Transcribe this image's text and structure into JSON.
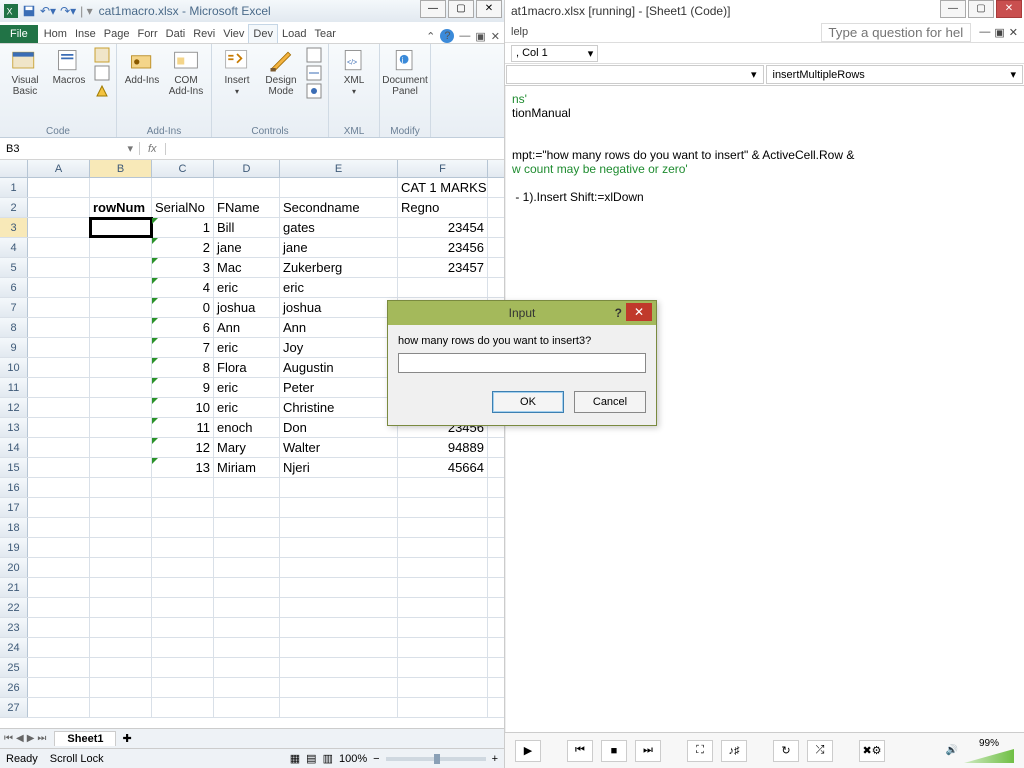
{
  "excel": {
    "title": "cat1macro.xlsx - Microsoft Excel",
    "tabs": {
      "file": "File",
      "list": [
        "Hom",
        "Inse",
        "Page",
        "Forr",
        "Dati",
        "Revi",
        "Viev",
        "Dev",
        "Load",
        "Tear"
      ],
      "active": 7
    },
    "ribbon": {
      "code": {
        "label": "Code",
        "visualBasic": "Visual\nBasic",
        "macros": "Macros"
      },
      "addins": {
        "label": "Add-Ins",
        "addins": "Add-Ins",
        "com": "COM\nAdd-Ins"
      },
      "controls": {
        "label": "Controls",
        "insert": "Insert",
        "design": "Design\nMode"
      },
      "xml": {
        "label": "XML",
        "xml": "XML"
      },
      "modify": {
        "label": "Modify",
        "doc": "Document\nPanel"
      }
    },
    "namebox": "B3",
    "columns": [
      "A",
      "B",
      "C",
      "D",
      "E",
      "F"
    ],
    "headers": {
      "rowNum": "rowNum",
      "serial": "SerialNo",
      "fname": "FName",
      "second": "Secondname",
      "regno": "Regno",
      "title": "CAT 1 MARKS"
    },
    "rows": [
      {
        "s": "1",
        "f": "Bill",
        "l": "gates",
        "r": "23454"
      },
      {
        "s": "2",
        "f": "jane",
        "l": "jane",
        "r": "23456"
      },
      {
        "s": "3",
        "f": "Mac",
        "l": "Zukerberg",
        "r": "23457"
      },
      {
        "s": "4",
        "f": "eric",
        "l": "eric",
        "r": ""
      },
      {
        "s": "0",
        "f": "joshua",
        "l": "joshua",
        "r": ""
      },
      {
        "s": "6",
        "f": "Ann",
        "l": "Ann",
        "r": ""
      },
      {
        "s": "7",
        "f": "eric",
        "l": "Joy",
        "r": ""
      },
      {
        "s": "8",
        "f": "Flora",
        "l": "Augustin",
        "r": ""
      },
      {
        "s": "9",
        "f": "eric",
        "l": "Peter",
        "r": ""
      },
      {
        "s": "10",
        "f": "eric",
        "l": "Christine",
        "r": ""
      },
      {
        "s": "11",
        "f": "enoch",
        "l": "Don",
        "r": "23456"
      },
      {
        "s": "12",
        "f": "Mary",
        "l": "Walter",
        "r": "94889"
      },
      {
        "s": "13",
        "f": "Miriam",
        "l": "Njeri",
        "r": "45664"
      }
    ],
    "sheet": "Sheet1",
    "status": {
      "ready": "Ready",
      "scroll": "Scroll Lock",
      "zoom": "100%"
    }
  },
  "vbe": {
    "title": "at1macro.xlsx [running] - [Sheet1 (Code)]",
    "menu": "lelp",
    "ask": "Type a question for help",
    "loc": ", Col 1",
    "dd_left": "",
    "dd_right": "insertMultipleRows",
    "code_lines": [
      {
        "t": "ns'",
        "c": "c1"
      },
      {
        "t": "tionManual",
        "c": ""
      },
      {
        "t": "",
        "c": ""
      },
      {
        "t": "",
        "c": ""
      },
      {
        "t": "mpt:=\"how many rows do you want to insert\" & ActiveCell.Row &",
        "c": ""
      },
      {
        "t": "w count may be negative or zero'",
        "c": "c1"
      },
      {
        "t": "",
        "c": ""
      },
      {
        "t": " - 1).Insert Shift:=xlDown",
        "c": ""
      }
    ],
    "volume": "99%"
  },
  "dialog": {
    "title": "Input",
    "prompt": "how many rows do you want to insert3?",
    "ok": "OK",
    "cancel": "Cancel"
  },
  "colW": {
    "A": 62,
    "B": 62,
    "C": 62,
    "D": 66,
    "E": 118,
    "F": 90
  }
}
